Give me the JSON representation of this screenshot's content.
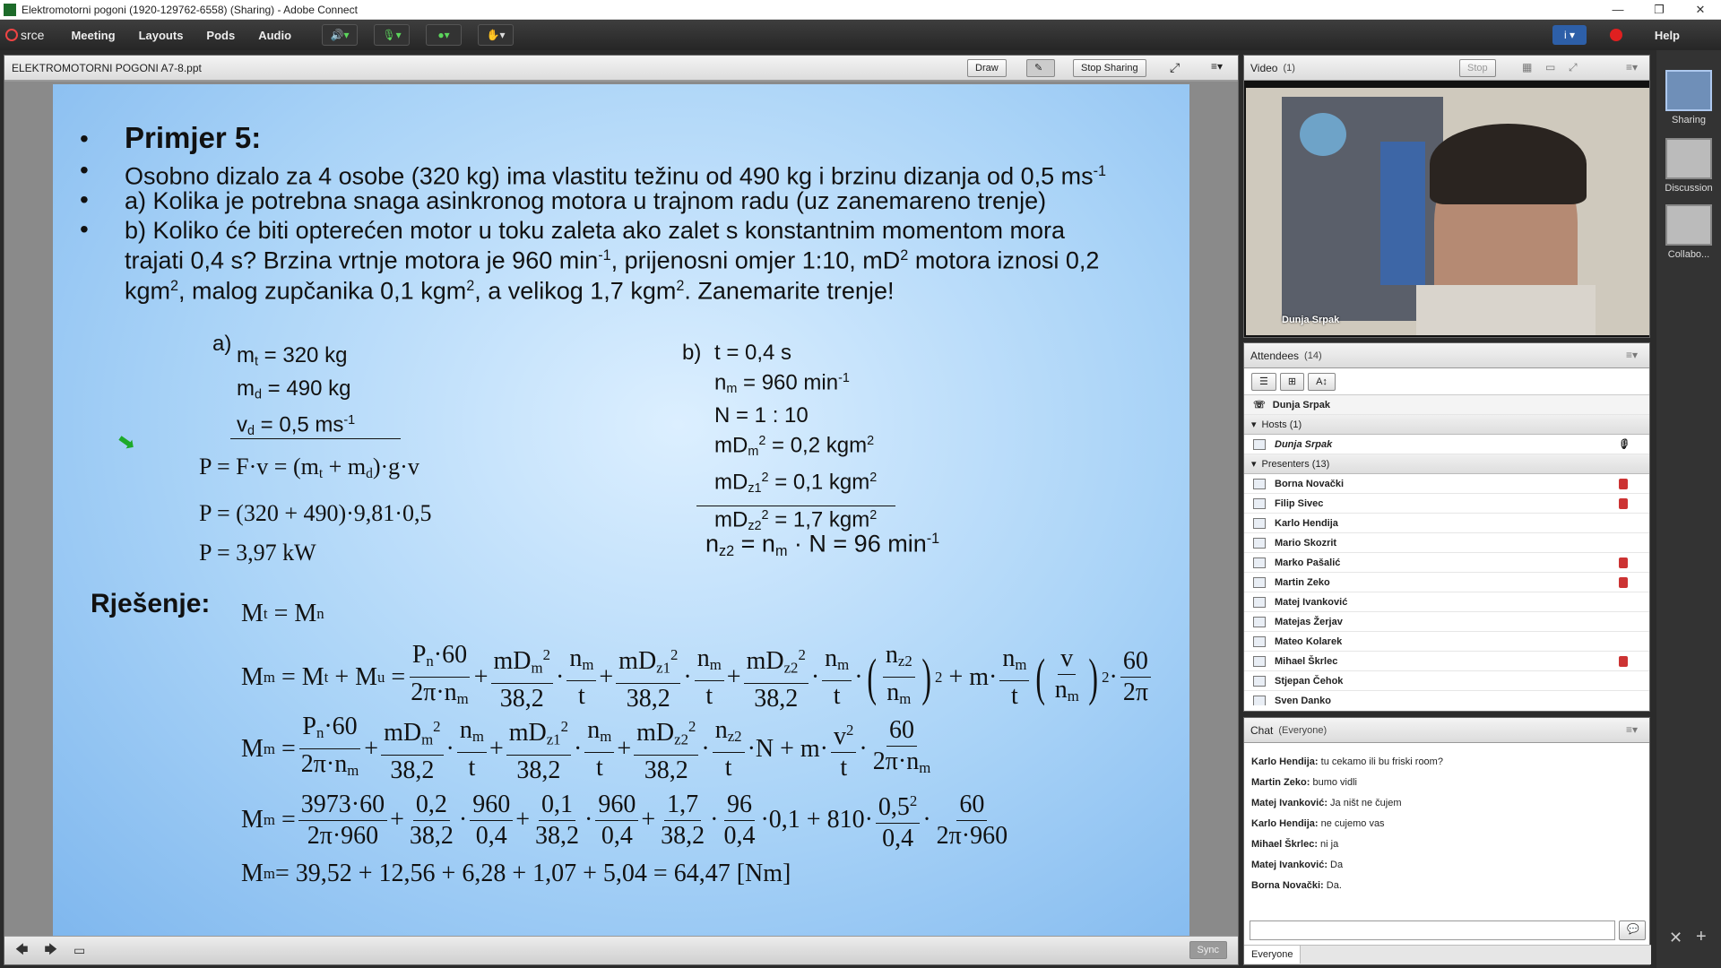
{
  "window": {
    "title": "Elektromotorni pogoni (1920-129762-6558) (Sharing) - Adobe Connect",
    "controls": [
      "—",
      "❐",
      "✕"
    ]
  },
  "menubar": {
    "logo": "srce",
    "items": [
      "Meeting",
      "Layouts",
      "Pods",
      "Audio"
    ],
    "help": "Help",
    "info": "i ▾"
  },
  "share_pod": {
    "title": "ELEKTROMOTORNI POGONI A7-8.ppt",
    "draw": "Draw",
    "stop_sharing": "Stop Sharing",
    "sync": "Sync"
  },
  "slide": {
    "bullets": [
      "Primjer 5:",
      "Osobno dizalo za 4 osobe (320 kg) ima vlastitu težinu od 490 kg i brzinu dizanja od 0,5 ms",
      "a) Kolika je potrebna snaga asinkronog motora u trajnom radu (uz zanemareno trenje)",
      "b) Koliko će biti opterećen motor u toku zaleta ako zalet s konstantnim momentom mora",
      "trajati 0,4 s? Brzina vrtnje motora je 960 min",
      ", prijenosni omjer 1:10, mD",
      " motora iznosi 0,2",
      "kgm",
      ", malog zupčanika 0,1 kgm",
      ", a velikog 1,7 kgm",
      ". Zanemarite trenje!"
    ],
    "sup_minus1": "-1",
    "sup_2": "2",
    "part_a": {
      "label": "a)",
      "l1a": "m",
      "l1s": "t",
      "l1b": " = 320 kg",
      "l2a": "m",
      "l2s": "d",
      "l2b": " = 490 kg",
      "l3a": "v",
      "l3s": "d",
      "l3b": " = 0,5 ms",
      "p1": "P = F·v = (m",
      "p1t": "t",
      "p1b": " + m",
      "p1d": "d",
      "p1c": ")·g·v",
      "p2": "P = (320 + 490)·9,81·0,5",
      "p3": "P = 3,97 kW"
    },
    "part_b": {
      "label": "b)",
      "t": "t = 0,4 s",
      "nm_a": "n",
      "nm_s": "m",
      "nm_b": " = 960 min",
      "N": "N = 1 : 10",
      "mdm_a": "mD",
      "mdm_s": "m",
      "mdm_b": " = 0,2 kgm",
      "mdz1_a": "mD",
      "mdz1_s": "z1",
      "mdz1_b": " = 0,1 kgm",
      "mdz2_a": "mD",
      "mdz2_s": "z2",
      "mdz2_b": " = 1,7 kgm",
      "res_a": "n",
      "res_s": "z2",
      "res_b": " = n",
      "res_s2": "m",
      "res_c": " · N = 96 min"
    },
    "solution_label": "Rješenje:",
    "eq_final": "M",
    "eq_final_sub": "m",
    "eq_final_rhs": " = 39,52 + 12,56 + 6,28 + 1,07 + 5,04 = 64,47 [Nm]"
  },
  "video_pod": {
    "title": "Video",
    "count": "(1)",
    "stop": "Stop",
    "name": "Dunja Srpak"
  },
  "attendees_pod": {
    "title": "Attendees",
    "count": "(14)",
    "me": "Dunja Srpak",
    "hosts_label": "Hosts (1)",
    "hosts": [
      "Dunja Srpak"
    ],
    "presenters_label": "Presenters (13)",
    "presenters": [
      "Borna Novački",
      "Filip Sivec",
      "Karlo Hendija",
      "Mario Skozrit",
      "Marko Pašalić",
      "Martin Zeko",
      "Matej Ivanković",
      "Matejas Žerjav",
      "Mateo Kolarek",
      "Mihael Škrlec",
      "Stjepan Čehok",
      "Sven Danko"
    ],
    "muted": [
      true,
      true,
      false,
      false,
      true,
      true,
      false,
      false,
      false,
      true,
      false,
      false
    ]
  },
  "chat_pod": {
    "title": "Chat",
    "scope": "(Everyone)",
    "tab": "Everyone",
    "messages": [
      {
        "from": "Karlo Hendija:",
        "text": " tu cekamo ili bu friski room?"
      },
      {
        "from": "Martin Zeko:",
        "text": " bumo vidli"
      },
      {
        "from": "Matej Ivanković:",
        "text": " Ja ništ ne čujem"
      },
      {
        "from": "Karlo Hendija:",
        "text": " ne cujemo vas"
      },
      {
        "from": "Mihael Škrlec:",
        "text": " ni ja"
      },
      {
        "from": "Matej Ivanković:",
        "text": " Da"
      },
      {
        "from": "Borna Novački:",
        "text": " Da."
      }
    ]
  },
  "sidebar": {
    "items": [
      "Sharing",
      "Discussion",
      "Collabo..."
    ]
  }
}
